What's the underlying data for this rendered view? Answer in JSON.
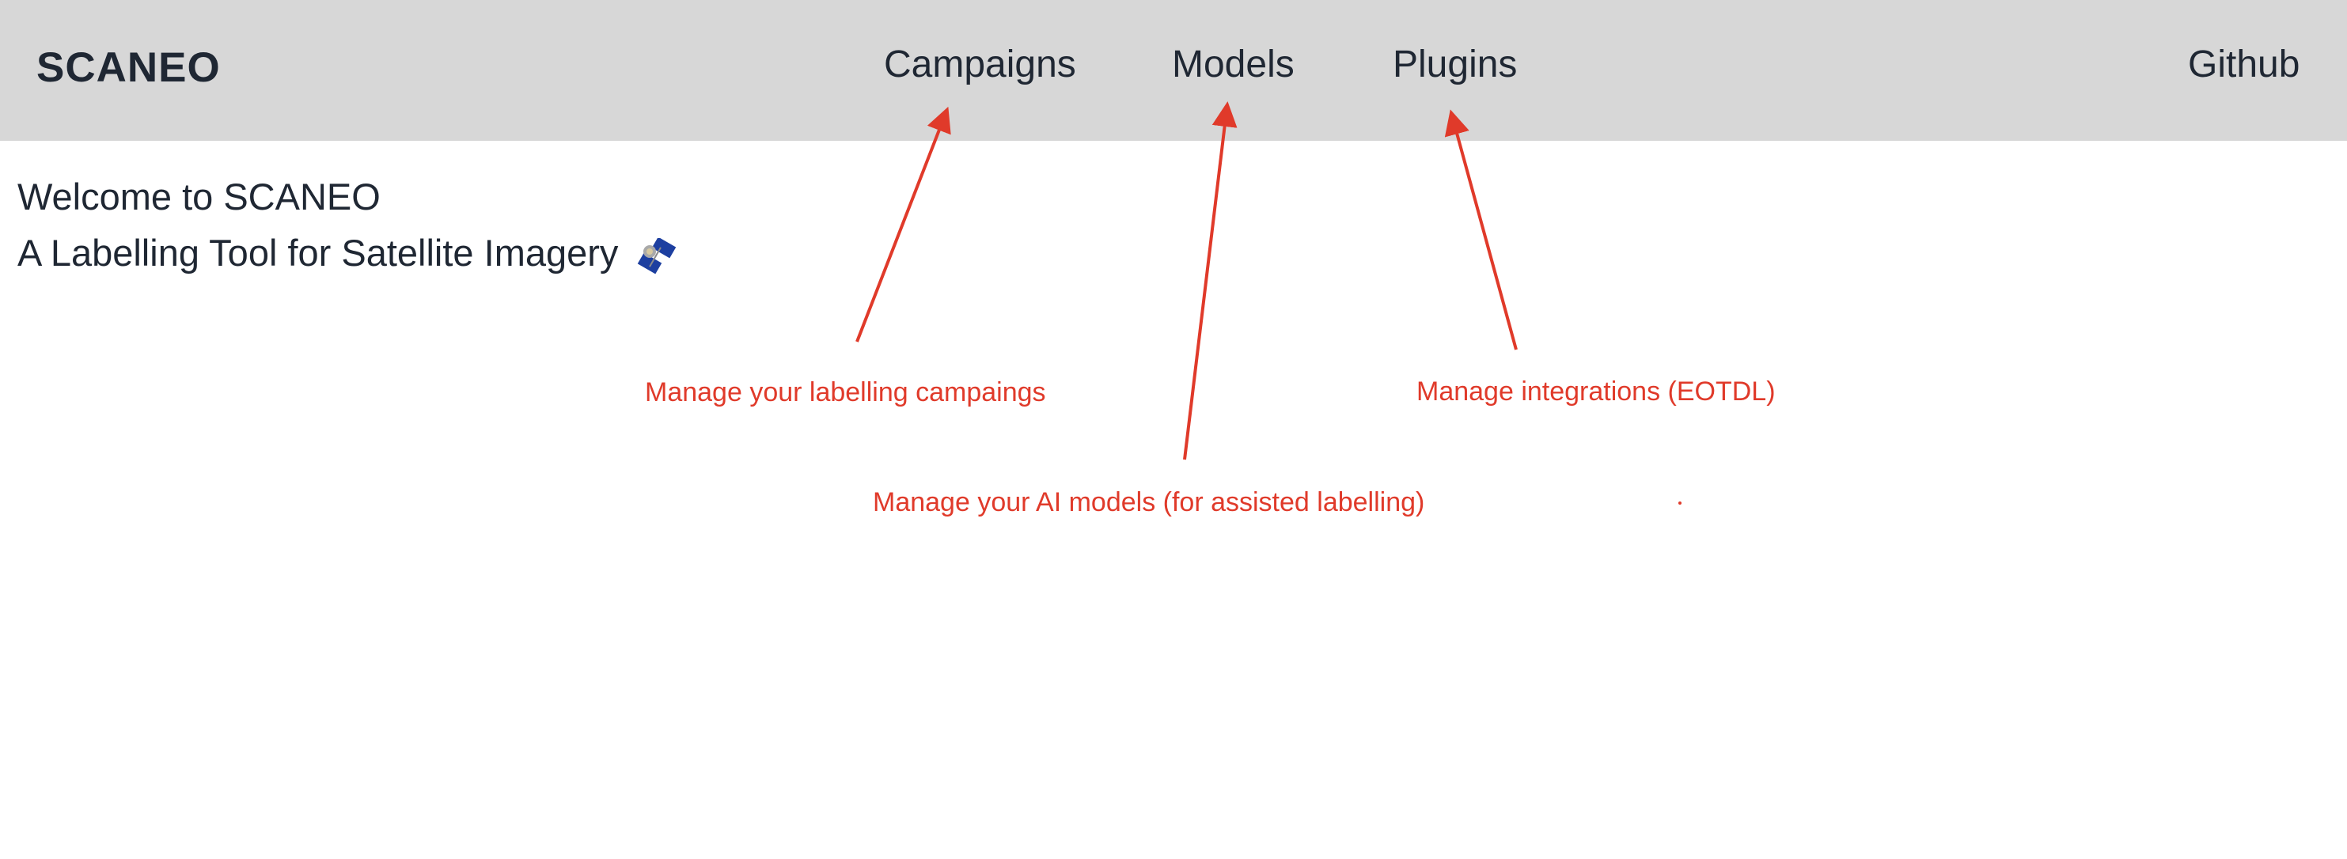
{
  "header": {
    "brand": "SCANEO",
    "nav": {
      "campaigns": "Campaigns",
      "models": "Models",
      "plugins": "Plugins",
      "github": "Github"
    }
  },
  "main": {
    "title": "Welcome to SCANEO",
    "subtitle": "A Labelling Tool for Satellite Imagery",
    "subtitle_icon": "satellite-icon"
  },
  "annotations": {
    "campaigns": "Manage your labelling campaings",
    "models": "Manage your AI models (for assisted labelling)",
    "plugins": "Manage integrations (EOTDL)"
  },
  "colors": {
    "header_bg": "#d7d7d7",
    "text": "#1f2733",
    "annotation": "#e03a2a"
  }
}
